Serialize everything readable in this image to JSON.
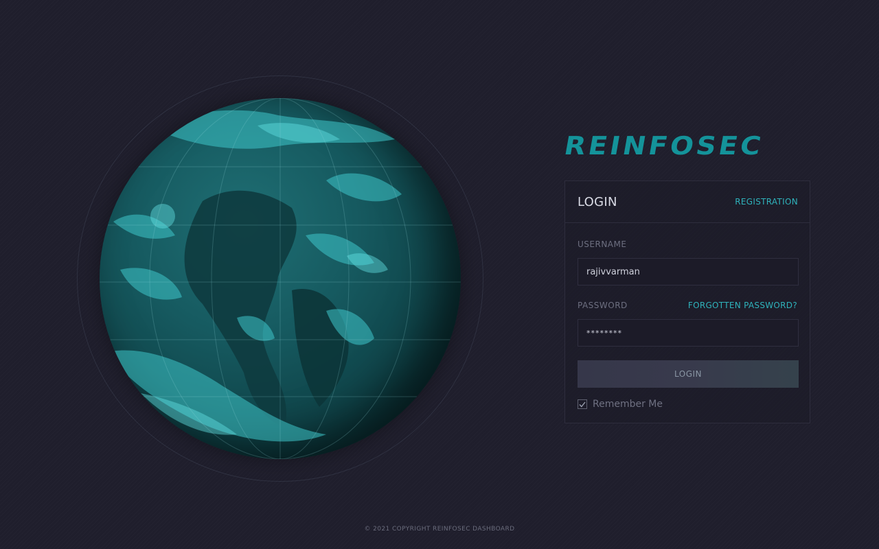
{
  "brand": {
    "logo_text": "REINFOSEC",
    "accent_color": "#14939a",
    "link_color": "#2fb3bc"
  },
  "login_card": {
    "title": "LOGIN",
    "registration_link": "REGISTRATION",
    "username_label": "USERNAME",
    "username_value": "rajivvarman",
    "password_label": "PASSWORD",
    "forgot_password_link": "FORGOTTEN PASSWORD?",
    "password_value": "********",
    "login_button": "LOGIN",
    "remember_me_label": "Remember Me",
    "remember_me_checked": true
  },
  "globe": {
    "icon": "earth-globe-icon"
  },
  "footer": {
    "copyright": "© 2021 COPYRIGHT REINFOSEC DASHBOARD"
  }
}
